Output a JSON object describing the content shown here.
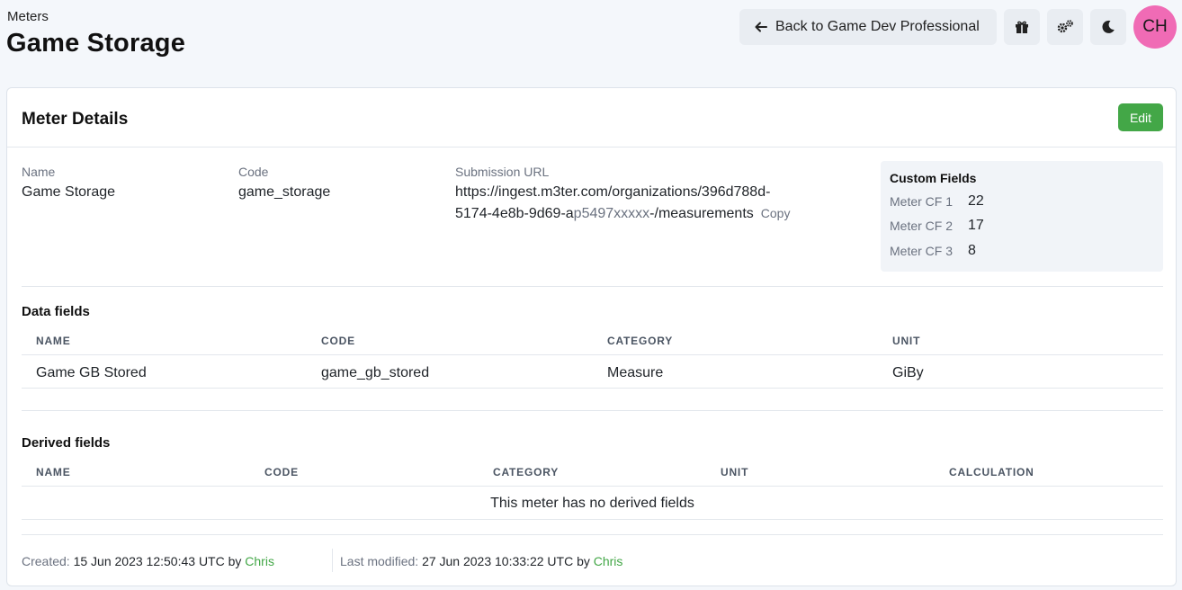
{
  "header": {
    "breadcrumb": "Meters",
    "title": "Game Storage",
    "back_label": "Back to Game Dev Professional",
    "avatar_initials": "CH"
  },
  "details": {
    "title": "Meter Details",
    "edit_label": "Edit",
    "name_label": "Name",
    "name_value": "Game Storage",
    "code_label": "Code",
    "code_value": "game_storage",
    "url_label": "Submission URL",
    "url_line1": "https://ingest.m3ter.com/organizations/396d788d-",
    "url_line2_a": "5174-4e8b-9d69-a",
    "url_line2_masked": "p5497xxxxx",
    "url_line2_b": "-/measurements",
    "copy_label": "Copy",
    "custom_fields": {
      "title": "Custom Fields",
      "items": [
        {
          "label": "Meter CF 1",
          "value": "22"
        },
        {
          "label": "Meter CF 2",
          "value": "17"
        },
        {
          "label": "Meter CF 3",
          "value": "8"
        }
      ]
    }
  },
  "data_fields": {
    "title": "Data fields",
    "headers": [
      "NAME",
      "CODE",
      "CATEGORY",
      "UNIT"
    ],
    "rows": [
      [
        "Game GB Stored",
        "game_gb_stored",
        "Measure",
        "GiBy"
      ]
    ]
  },
  "derived_fields": {
    "title": "Derived fields",
    "headers": [
      "NAME",
      "CODE",
      "CATEGORY",
      "UNIT",
      "CALCULATION"
    ],
    "empty_text": "This meter has no derived fields"
  },
  "footer": {
    "created_label": "Created:",
    "created_value": "15 Jun 2023 12:50:43 UTC by",
    "created_by": "Chris",
    "modified_label": "Last modified:",
    "modified_value": "27 Jun 2023 10:33:22 UTC by",
    "modified_by": "Chris"
  },
  "colors": {
    "accent": "#43a747",
    "avatar": "#f06bb5"
  },
  "icons": [
    "arrow-left-icon",
    "gift-icon",
    "gears-icon",
    "moon-icon"
  ]
}
